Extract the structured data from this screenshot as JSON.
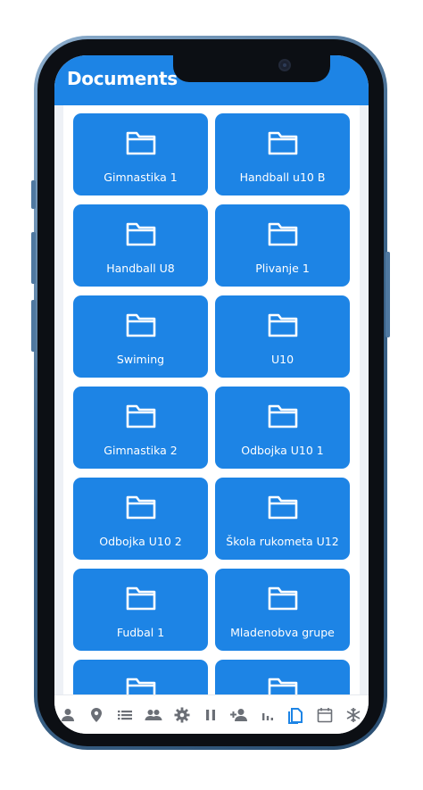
{
  "header": {
    "title": "Documents"
  },
  "folders": [
    {
      "name": "Gimnastika 1"
    },
    {
      "name": "Handball u10 B"
    },
    {
      "name": "Handball U8"
    },
    {
      "name": "Plivanje 1"
    },
    {
      "name": "Swiming"
    },
    {
      "name": "U10"
    },
    {
      "name": "Gimnastika 2"
    },
    {
      "name": "Odbojka U10 1"
    },
    {
      "name": "Odbojka U10 2"
    },
    {
      "name": "Škola rukometa U12"
    },
    {
      "name": "Fudbal 1"
    },
    {
      "name": "Mladenobva grupe"
    }
  ],
  "bottom_nav": {
    "items": [
      {
        "icon": "person-icon"
      },
      {
        "icon": "location-pin-icon"
      },
      {
        "icon": "list-icon"
      },
      {
        "icon": "people-icon"
      },
      {
        "icon": "gear-icon"
      },
      {
        "icon": "pause-icon"
      },
      {
        "icon": "add-person-icon"
      },
      {
        "icon": "bar-chart-icon"
      },
      {
        "icon": "documents-icon",
        "active": true
      },
      {
        "icon": "calendar-icon"
      },
      {
        "icon": "snowflake-icon"
      }
    ]
  },
  "colors": {
    "accent": "#1d84e5",
    "inactive_icon": "#6b6f76"
  }
}
